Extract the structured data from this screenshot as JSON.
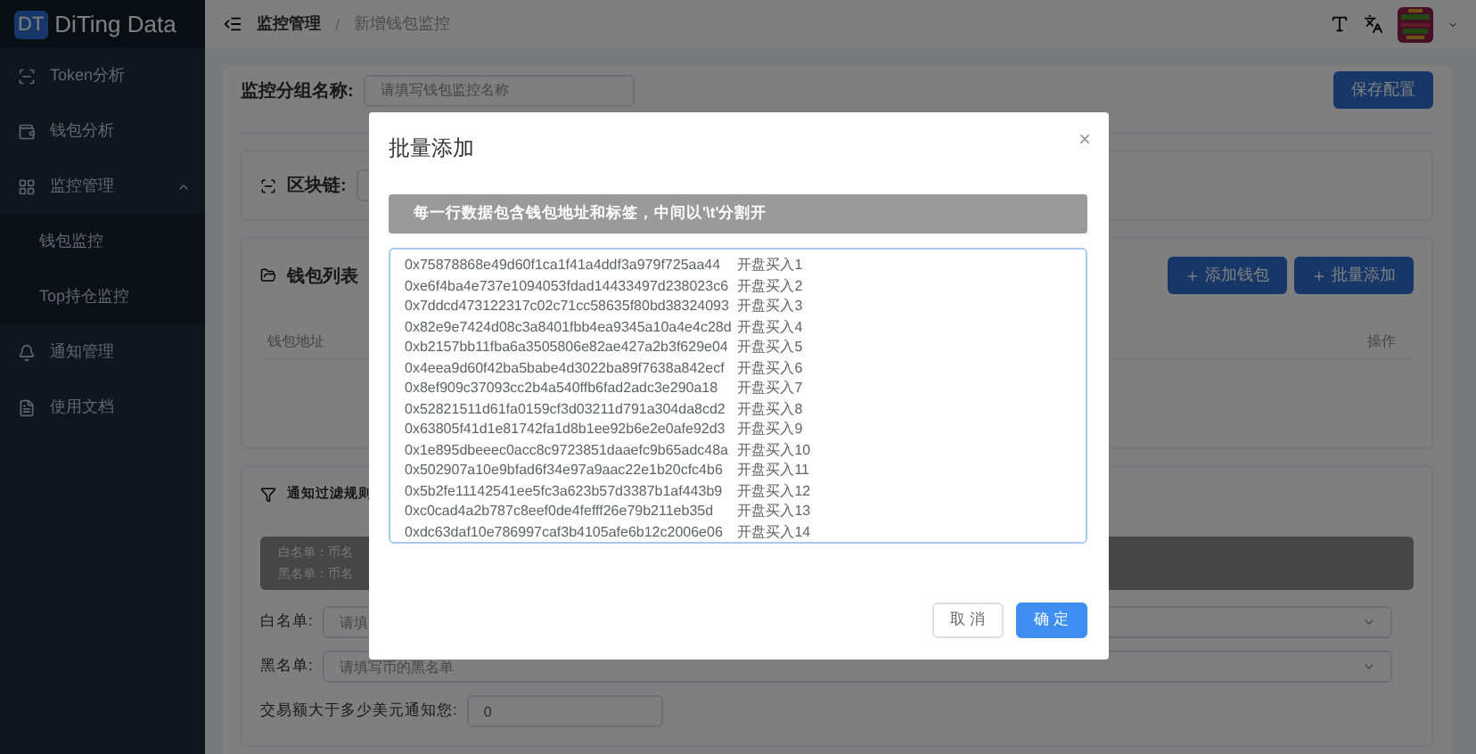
{
  "brand": {
    "logo": "DT",
    "name": "DiTing Data"
  },
  "sidebar": {
    "items": [
      {
        "label": "Token分析"
      },
      {
        "label": "钱包分析"
      },
      {
        "label": "监控管理",
        "expanded": true,
        "children": [
          {
            "label": "钱包监控"
          },
          {
            "label": "Top持仓监控"
          }
        ]
      },
      {
        "label": "通知管理"
      },
      {
        "label": "使用文档"
      }
    ]
  },
  "breadcrumb": [
    "监控管理",
    "新增钱包监控"
  ],
  "breadcrumb_separator": "/",
  "group_form": {
    "label": "监控分组名称:",
    "placeholder": "请填写钱包监控名称",
    "save_button": "保存配置"
  },
  "chain_form": {
    "label": "区块链:"
  },
  "wallet_list": {
    "title": "钱包列表",
    "buttons": [
      "添加钱包",
      "批量添加"
    ],
    "columns": [
      "钱包地址",
      "操作"
    ]
  },
  "filter_rules": {
    "title": "通知过滤规则",
    "info": [
      "白名单：币名",
      "黑名单：币名"
    ],
    "fields": [
      {
        "label": "白名单:",
        "placeholder": "请填",
        "kind": "select"
      },
      {
        "label": "黑名单:",
        "placeholder": "请填写币的黑名单",
        "kind": "select"
      },
      {
        "label": "交易额大于多少美元通知您:",
        "value": "0",
        "kind": "input"
      }
    ]
  },
  "dialog": {
    "title": "批量添加",
    "close": "×",
    "hint": "每一行数据包含钱包地址和标签，中间以'\\t'分割开",
    "lines": [
      {
        "address": "0x75878868e49d60f1ca1f41a4ddf3a979f725aa44",
        "label": "开盘买入1"
      },
      {
        "address": "0xe6f4ba4e737e1094053fdad14433497d238023c6",
        "label": "开盘买入2"
      },
      {
        "address": "0x7ddcd473122317c02c71cc58635f80bd38324093",
        "label": "开盘买入3"
      },
      {
        "address": "0x82e9e7424d08c3a8401fbb4ea9345a10a4e4c28d",
        "label": "开盘买入4"
      },
      {
        "address": "0xb2157bb11fba6a3505806e82ae427a2b3f629e04",
        "label": "开盘买入5"
      },
      {
        "address": "0x4eea9d60f42ba5babe4d3022ba89f7638a842ecf",
        "label": "开盘买入6"
      },
      {
        "address": "0x8ef909c37093cc2b4a540ffb6fad2adc3e290a18",
        "label": "开盘买入7"
      },
      {
        "address": "0x52821511d61fa0159cf3d03211d791a304da8cd2",
        "label": "开盘买入8"
      },
      {
        "address": "0x63805f41d1e81742fa1d8b1ee92b6e2e0afe92d3",
        "label": "开盘买入9"
      },
      {
        "address": "0x1e895dbeeec0acc8c9723851daaefc9b65adc48a",
        "label": "开盘买入10"
      },
      {
        "address": "0x502907a10e9bfad6f34e97a9aac22e1b20cfc4b6",
        "label": "开盘买入11"
      },
      {
        "address": "0x5b2fe11142541ee5fc3a623b57d3387b1af443b9",
        "label": "开盘买入12"
      },
      {
        "address": "0xc0cad4a2b787c8eef0de4fefff26e79b211eb35d",
        "label": "开盘买入13"
      },
      {
        "address": "0xdc63daf10e786997caf3b4105afe6b12c2006e06",
        "label": "开盘买入14"
      }
    ],
    "buttons": [
      {
        "label": "取 消",
        "kind": "default"
      },
      {
        "label": "确 定",
        "kind": "primary"
      }
    ]
  }
}
